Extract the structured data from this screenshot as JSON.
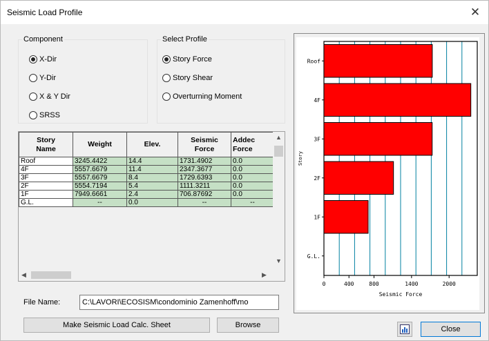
{
  "window": {
    "title": "Seismic Load Profile"
  },
  "component": {
    "label": "Component",
    "options": [
      {
        "label": "X-Dir",
        "selected": true
      },
      {
        "label": "Y-Dir",
        "selected": false
      },
      {
        "label": "X & Y Dir",
        "selected": false
      },
      {
        "label": "SRSS",
        "selected": false
      }
    ]
  },
  "profile": {
    "label": "Select Profile",
    "options": [
      {
        "label": "Story Force",
        "selected": true
      },
      {
        "label": "Story Shear",
        "selected": false
      },
      {
        "label": "Overturning Moment",
        "selected": false
      }
    ]
  },
  "table": {
    "headers": [
      "Story\nName",
      "Weight",
      "Elev.",
      "Seismic\nForce",
      "Addec\nForce"
    ],
    "rows": [
      [
        "Roof",
        "3245.4422",
        "14.4",
        "1731.4902",
        "0.0"
      ],
      [
        "4F",
        "5557.6679",
        "11.4",
        "2347.3677",
        "0.0"
      ],
      [
        "3F",
        "5557.6679",
        "8.4",
        "1729.6393",
        "0.0"
      ],
      [
        "2F",
        "5554.7194",
        "5.4",
        "1111.3211",
        "0.0"
      ],
      [
        "1F",
        "7949.6661",
        "2.4",
        "706.87692",
        "0.0"
      ],
      [
        "G.L.",
        "--",
        "0.0",
        "--",
        "--"
      ]
    ]
  },
  "file": {
    "label": "File Name:",
    "value": "C:\\LAVORI\\ECOSISM\\condominio Zamenhoff\\mo"
  },
  "buttons": {
    "make_sheet": "Make Seismic Load Calc. Sheet",
    "browse": "Browse",
    "close": "Close",
    "chart_icon": "chart-icon"
  },
  "chart_data": {
    "type": "bar",
    "orientation": "horizontal",
    "categories": [
      "Roof",
      "4F",
      "3F",
      "2F",
      "1F",
      "G.L."
    ],
    "values": [
      1731.49,
      2347.37,
      1729.64,
      1111.32,
      706.88,
      0
    ],
    "xlabel": "Seismic Force",
    "ylabel": "Story",
    "xlim": [
      0,
      2450
    ],
    "xticks": [
      0,
      400,
      800,
      1400,
      2000
    ],
    "bar_color": "#ff0000",
    "grid_color": "#0080a0"
  }
}
